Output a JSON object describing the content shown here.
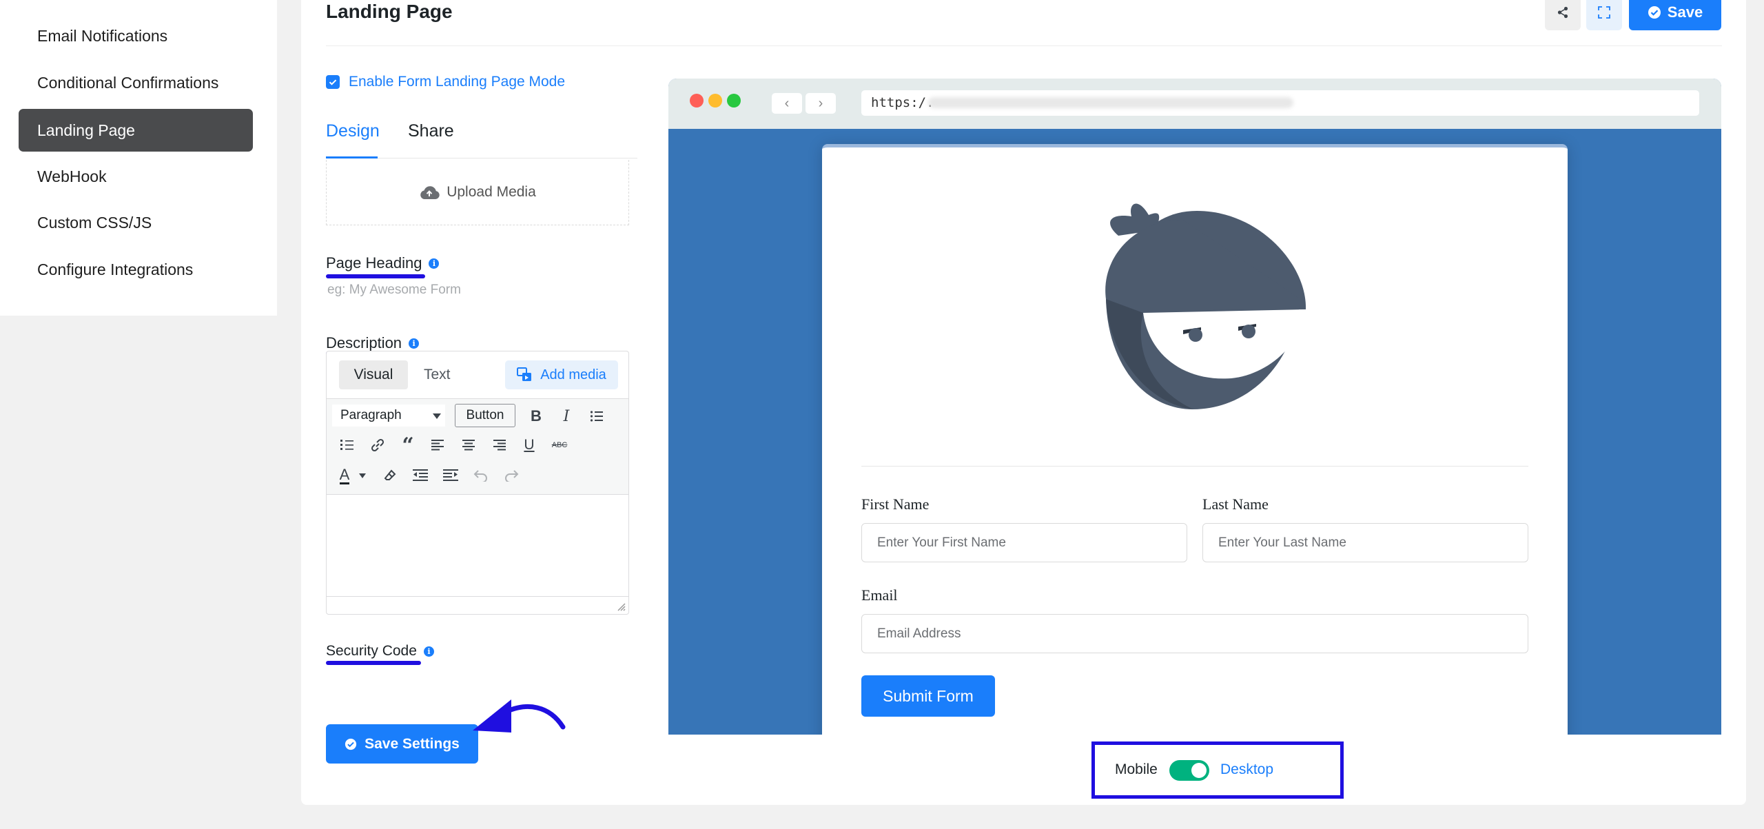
{
  "sidebar": {
    "items": [
      {
        "label": "Email Notifications"
      },
      {
        "label": "Conditional Confirmations"
      },
      {
        "label": "Landing Page"
      },
      {
        "label": "WebHook"
      },
      {
        "label": "Custom CSS/JS"
      },
      {
        "label": "Configure Integrations"
      }
    ],
    "active": "Landing Page"
  },
  "header": {
    "title": "Landing Page",
    "save_label": "Save"
  },
  "settings": {
    "enable_label": "Enable Form Landing Page Mode",
    "enable_checked": true,
    "tabs": [
      {
        "label": "Design"
      },
      {
        "label": "Share"
      }
    ],
    "active_tab": "Design",
    "upload_label": "Upload Media",
    "page_heading_label": "Page Heading",
    "page_heading_placeholder": "eg: My Awesome Form",
    "description_label": "Description",
    "security_code_label": "Security Code",
    "save_settings_label": "Save Settings"
  },
  "editor": {
    "tab_visual": "Visual",
    "tab_text": "Text",
    "add_media": "Add media",
    "format_select": "Paragraph",
    "button_label": "Button",
    "strikethrough_label": "ABC"
  },
  "preview": {
    "url": "https:/.",
    "form": {
      "first_name_label": "First Name",
      "first_name_placeholder": "Enter Your First Name",
      "last_name_label": "Last Name",
      "last_name_placeholder": "Enter Your Last Name",
      "email_label": "Email",
      "email_placeholder": "Email Address",
      "submit_label": "Submit Form"
    }
  },
  "view_toggle": {
    "mobile_label": "Mobile",
    "desktop_label": "Desktop",
    "desktop_active": true
  },
  "colors": {
    "accent": "#1a7efb",
    "annotation": "#1f0fe0",
    "toggle_on": "#00b27f",
    "preview_bg": "#3775b7"
  }
}
